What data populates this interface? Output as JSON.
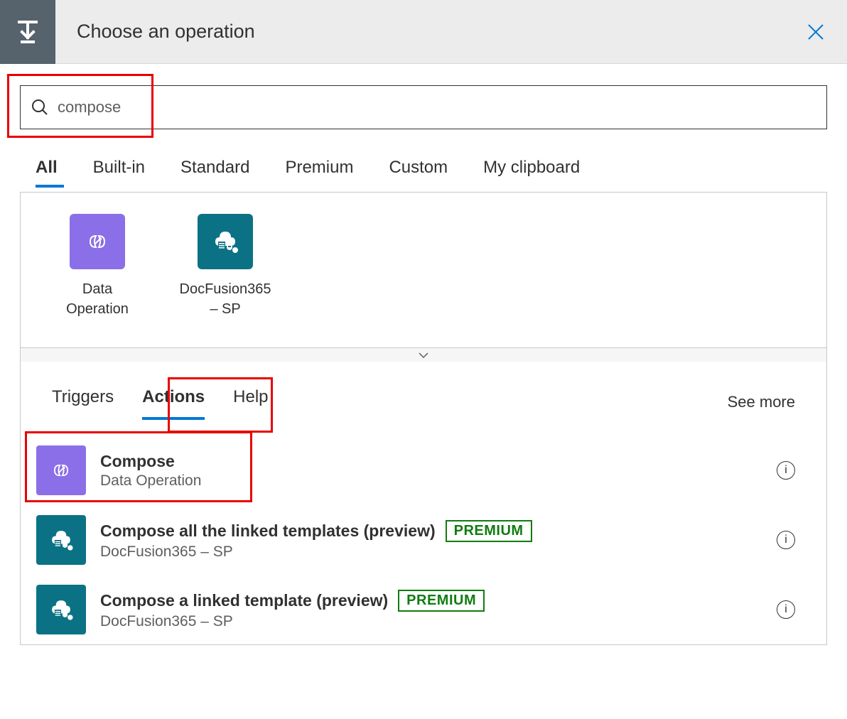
{
  "header": {
    "title": "Choose an operation"
  },
  "search": {
    "value": "compose"
  },
  "categoryTabs": [
    {
      "label": "All",
      "active": true
    },
    {
      "label": "Built-in",
      "active": false
    },
    {
      "label": "Standard",
      "active": false
    },
    {
      "label": "Premium",
      "active": false
    },
    {
      "label": "Custom",
      "active": false
    },
    {
      "label": "My clipboard",
      "active": false
    }
  ],
  "connectors": [
    {
      "icon": "data-operation",
      "label": "Data Operation",
      "color": "purple"
    },
    {
      "icon": "docfusion",
      "label": "DocFusion365 – SP",
      "color": "teal"
    }
  ],
  "subTabs": [
    {
      "label": "Triggers",
      "active": false
    },
    {
      "label": "Actions",
      "active": true
    },
    {
      "label": "Help",
      "active": false
    }
  ],
  "seeMore": "See more",
  "actions": [
    {
      "title": "Compose",
      "subtitle": "Data Operation",
      "icon": "purple",
      "premium": false
    },
    {
      "title": "Compose all the linked templates (preview)",
      "subtitle": "DocFusion365 – SP",
      "icon": "teal",
      "premium": true
    },
    {
      "title": "Compose a linked template (preview)",
      "subtitle": "DocFusion365 – SP",
      "icon": "teal",
      "premium": true
    }
  ],
  "premiumLabel": "PREMIUM"
}
